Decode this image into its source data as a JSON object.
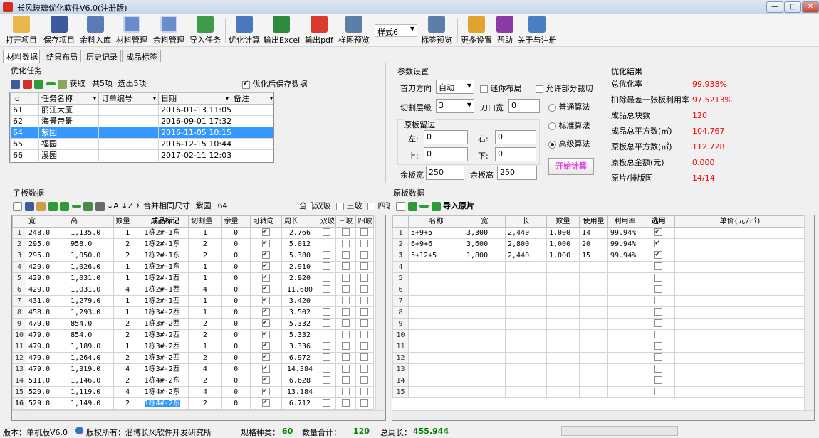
{
  "window": {
    "title": "长风玻璃优化软件V6.0(注册版)",
    "min": "—",
    "max": "□",
    "close": "✕"
  },
  "toolbar": {
    "items": [
      "打开项目",
      "保存项目",
      "余料入库",
      "材料管理",
      "余料管理",
      "导入任务",
      "优化计算",
      "输出Excel",
      "输出pdf",
      "样图预览",
      "样式6",
      "标签预览",
      "更多设置",
      "帮助",
      "关于与注册"
    ]
  },
  "tabs": [
    "材料数据",
    "结果布局",
    "历史记录",
    "成品标签"
  ],
  "task": {
    "title": "优化任务",
    "toolbar": {
      "fetch": "获取",
      "total": "共5项",
      "selected": "选出5项",
      "save_after": "优化后保存数据"
    },
    "headers": [
      "id",
      "任务名称",
      "订单编号",
      "日期",
      "备注"
    ],
    "rows": [
      {
        "id": "61",
        "name": "丽江大厦",
        "order": "",
        "date": "2016-01-13 11:05",
        "note": ""
      },
      {
        "id": "62",
        "name": "海景帝景",
        "order": "",
        "date": "2016-09-01 17:32",
        "note": ""
      },
      {
        "id": "64",
        "name": "紫园",
        "order": "",
        "date": "2016-11-05 10:15",
        "note": ""
      },
      {
        "id": "65",
        "name": "福园",
        "order": "",
        "date": "2016-12-15 10:44",
        "note": ""
      },
      {
        "id": "66",
        "name": "溪园",
        "order": "",
        "date": "2017-02-11 12:03",
        "note": ""
      }
    ]
  },
  "params": {
    "title": "参数设置",
    "first_cut_label": "首刀方向",
    "first_cut_value": "自动",
    "mini_layout": "迷你布局",
    "allow_partial": "允许部分裁切",
    "cut_levels_label": "切割层级",
    "cut_levels_value": "3",
    "kerf_label": "刀口宽",
    "kerf_value": "0",
    "margin_title": "原板留边",
    "left_label": "左:",
    "left_value": "0",
    "right_label": "右:",
    "right_value": "0",
    "top_label": "上:",
    "top_value": "0",
    "bottom_label": "下:",
    "bottom_value": "0",
    "algo_normal": "普通算法",
    "algo_standard": "标准算法",
    "algo_advanced": "高级算法",
    "remain_w_label": "余板宽",
    "remain_w_value": "250",
    "remain_h_label": "余板高",
    "remain_h_value": "250",
    "start_button": "开始计算"
  },
  "results": {
    "title": "优化结果",
    "items": [
      {
        "label": "总优化率",
        "value": "99.938%"
      },
      {
        "label": "扣除最差一张板利用率",
        "value": "97.5213%"
      },
      {
        "label": "成品总块数",
        "value": "120"
      },
      {
        "label": "成品总平方数(㎡)",
        "value": "104.767"
      },
      {
        "label": "原板总平方数(㎡)",
        "value": "112.728"
      },
      {
        "label": "原板总金额(元)",
        "value": "0.000"
      },
      {
        "label": "原片/排版图",
        "value": "14/14"
      }
    ]
  },
  "sub": {
    "title": "子板数据",
    "merge": "合并相同尺寸",
    "project": "紫园_",
    "count": "64",
    "select_all": "全选:",
    "double": "双玻",
    "triple": "三玻",
    "quad": "四玻",
    "headers": [
      "宽",
      "高",
      "数量",
      "成品标记",
      "切割量",
      "余量",
      "可转向",
      "周长",
      "双玻",
      "三玻",
      "四玻"
    ],
    "rows": [
      [
        "1",
        "248.0",
        "1,135.0",
        "1",
        "1栋2#-1东",
        "1",
        "0",
        "2.766"
      ],
      [
        "2",
        "295.0",
        "958.0",
        "2",
        "1栋2#-1东",
        "2",
        "0",
        "5.012"
      ],
      [
        "3",
        "295.0",
        "1,050.0",
        "2",
        "1栋2#-1东",
        "2",
        "0",
        "5.380"
      ],
      [
        "4",
        "429.0",
        "1,026.0",
        "1",
        "1栋2#-1东",
        "1",
        "0",
        "2.910"
      ],
      [
        "5",
        "429.0",
        "1,031.0",
        "1",
        "1栋2#-1西",
        "1",
        "0",
        "2.920"
      ],
      [
        "6",
        "429.0",
        "1,031.0",
        "4",
        "1栋2#-1西",
        "4",
        "0",
        "11.680"
      ],
      [
        "7",
        "431.0",
        "1,279.0",
        "1",
        "1栋2#-1西",
        "1",
        "0",
        "3.420"
      ],
      [
        "8",
        "458.0",
        "1,293.0",
        "1",
        "1栋3#-2西",
        "1",
        "0",
        "3.502"
      ],
      [
        "9",
        "479.0",
        "854.0",
        "2",
        "1栋3#-2西",
        "2",
        "0",
        "5.332"
      ],
      [
        "10",
        "479.0",
        "854.0",
        "2",
        "1栋3#-2西",
        "2",
        "0",
        "5.332"
      ],
      [
        "11",
        "479.0",
        "1,189.0",
        "1",
        "1栋3#-2西",
        "1",
        "0",
        "3.336"
      ],
      [
        "12",
        "479.0",
        "1,264.0",
        "2",
        "1栋3#-2西",
        "2",
        "0",
        "6.972"
      ],
      [
        "13",
        "479.0",
        "1,319.0",
        "4",
        "1栋3#-2西",
        "4",
        "0",
        "14.384"
      ],
      [
        "14",
        "511.0",
        "1,146.0",
        "2",
        "1栋4#-2东",
        "2",
        "0",
        "6.628"
      ],
      [
        "15",
        "529.0",
        "1,119.0",
        "4",
        "1栋4#-2东",
        "4",
        "0",
        "13.184"
      ],
      [
        "16",
        "529.0",
        "1,149.0",
        "2",
        "1栋4#-2东",
        "2",
        "0",
        "6.712"
      ]
    ]
  },
  "raw": {
    "title": "原板数据",
    "import": "导入原片",
    "headers": [
      "名称",
      "宽",
      "长",
      "数量",
      "使用量",
      "利用率",
      "选用",
      "单价(元/㎡)"
    ],
    "rows": [
      [
        "1",
        "5+9+5",
        "3,300",
        "2,440",
        "1,000",
        "14",
        "99.94%"
      ],
      [
        "2",
        "6+9+6",
        "3,600",
        "2,800",
        "1,000",
        "20",
        "99.94%"
      ],
      [
        "3",
        "5+12+5",
        "1,800",
        "2,440",
        "1,000",
        "15",
        "99.94%"
      ],
      [
        "4"
      ],
      [
        "5"
      ],
      [
        "6"
      ],
      [
        "7"
      ],
      [
        "8"
      ],
      [
        "9"
      ],
      [
        "10"
      ],
      [
        "11"
      ],
      [
        "12"
      ],
      [
        "13"
      ],
      [
        "14"
      ],
      [
        "15"
      ]
    ]
  },
  "status": {
    "version": "版本：单机版V6.0",
    "copyright": "版权所有：淄博长风软件开发研究所",
    "kinds_label": "规格种类：",
    "kinds": "60",
    "qty_label": "数量合计：",
    "qty": "120",
    "perim_label": "总周长：",
    "perim": "455.944"
  }
}
